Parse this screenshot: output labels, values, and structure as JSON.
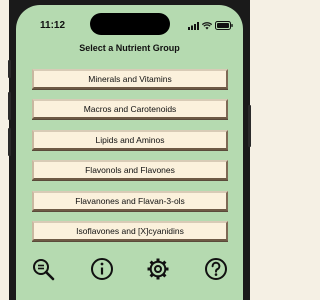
{
  "status": {
    "time": "11:12"
  },
  "screen": {
    "title": "Select a Nutrient Group"
  },
  "groups": [
    {
      "label": "Minerals and Vitamins"
    },
    {
      "label": "Macros and Carotenoids"
    },
    {
      "label": "Lipids and Aminos"
    },
    {
      "label": "Flavonols and Flavones"
    },
    {
      "label": "Flavanones and Flavan-3-ols"
    },
    {
      "label": "Isoflavones and [X]cyanidins"
    }
  ],
  "tabbar": {
    "icons": [
      "search-zoom-icon",
      "info-icon",
      "gear-icon",
      "help-icon"
    ]
  },
  "colors": {
    "screen_bg": "#b5dab0",
    "button_bg": "#fbf1dc",
    "button_border": "#a6937c"
  }
}
